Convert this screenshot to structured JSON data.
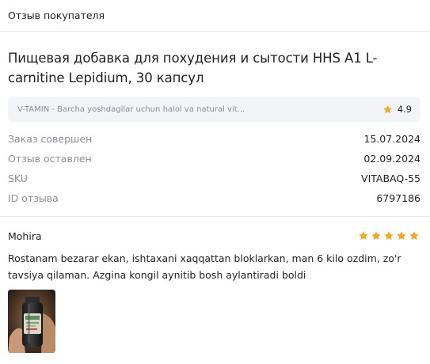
{
  "header": {
    "title": "Отзыв покупателя"
  },
  "product": {
    "title": "Пищевая добавка для похудения и сытости HHS A1 L-carnitine Lepidium, 30 капсул"
  },
  "seller": {
    "text": "V-TAMIN - Barcha yoshdagilar uchun halol va natural vit...",
    "rating": "4.9",
    "star_color": "#f5a623"
  },
  "info": [
    {
      "label": "Заказ совершен",
      "value": "15.07.2024"
    },
    {
      "label": "Отзыв оставлен",
      "value": "02.09.2024"
    },
    {
      "label": "SKU",
      "value": "VITABAQ-55"
    },
    {
      "label": "ID отзыва",
      "value": "6797186"
    }
  ],
  "review": {
    "author": "Mohira",
    "stars": 5,
    "text": "Rostanam bezarar ekan, ishtaxani xaqqattan bloklarkan, man 6 kilo ozdim, zo'r tavsiya qilaman. Azgina kongil aynitib bosh aylantiradi boldi",
    "photo_icon": "product-bottle-photo"
  }
}
